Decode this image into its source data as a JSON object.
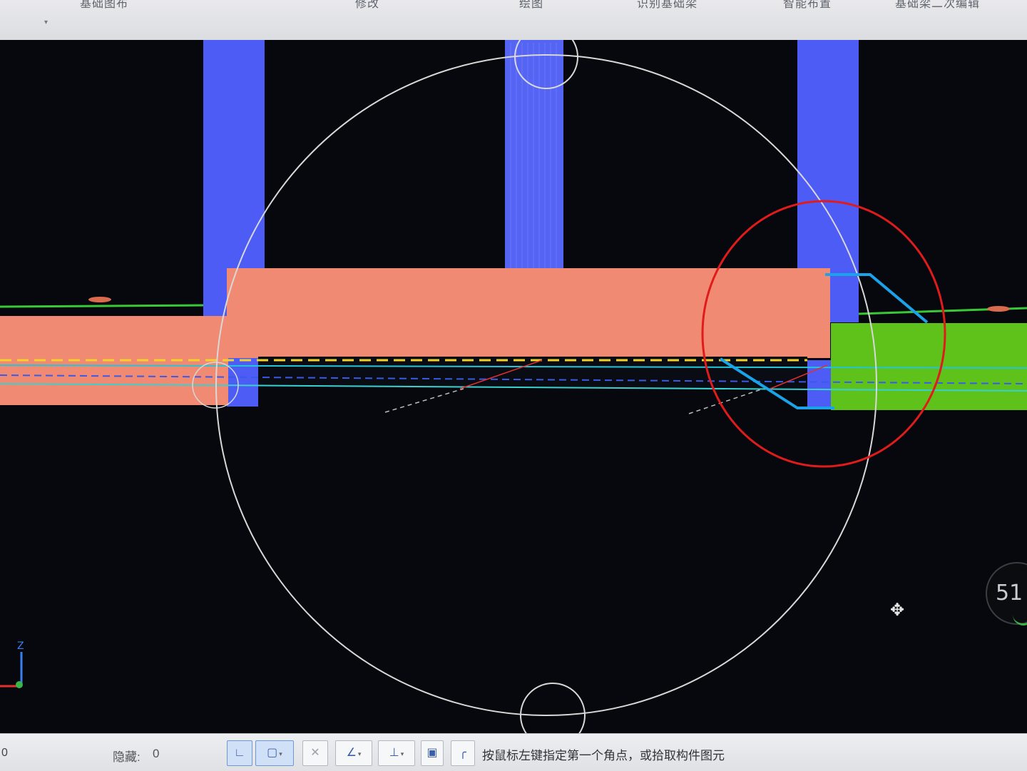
{
  "ribbon": {
    "items": [
      "基础图布",
      "修改",
      "绘图",
      "识别基础梁",
      "智能布置",
      "基础梁二次编辑"
    ]
  },
  "viewport": {
    "background": "#07080d",
    "colors": {
      "column": "#4d5cf5",
      "beam": "#f08a72",
      "green_beam": "#5ec21b",
      "selection_circle": "#d8d8d8",
      "annotation_circle": "#e01b1b",
      "annotation_line": "#1aa3e8"
    },
    "zoom_indicator": "51",
    "nav_cube_icon": "pan-rotate-icon",
    "axis_label_z": "Z"
  },
  "statusbar": {
    "left_value": "0",
    "hidden_label": "隐藏:",
    "hidden_value": "0",
    "tools": [
      {
        "name": "ortho-tool",
        "glyph": "∟",
        "active": true
      },
      {
        "name": "rect-select-tool",
        "glyph": "▢",
        "active": true
      },
      {
        "name": "cross-tool",
        "glyph": "✕",
        "active": false
      },
      {
        "name": "angle-tool",
        "glyph": "∠",
        "active": false
      },
      {
        "name": "dimension-tool",
        "glyph": "⊥",
        "active": false
      },
      {
        "name": "layer-tool",
        "glyph": "▣",
        "active": false
      },
      {
        "name": "curve-tool",
        "glyph": "╭",
        "active": false
      }
    ],
    "prompt": "按鼠标左键指定第一个角点，或拾取构件图元"
  }
}
